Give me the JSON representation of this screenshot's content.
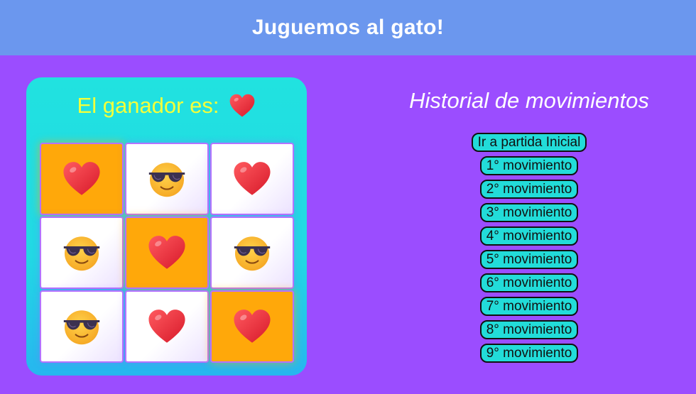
{
  "header": {
    "title": "Juguemos al gato!"
  },
  "status": {
    "label": "El ganador es:",
    "winner_icon": "heart-icon"
  },
  "board": {
    "cells": [
      {
        "mark": "heart",
        "highlight": true
      },
      {
        "mark": "cool",
        "highlight": false
      },
      {
        "mark": "heart",
        "highlight": false
      },
      {
        "mark": "cool",
        "highlight": false
      },
      {
        "mark": "heart",
        "highlight": true
      },
      {
        "mark": "cool",
        "highlight": false
      },
      {
        "mark": "cool",
        "highlight": false
      },
      {
        "mark": "heart",
        "highlight": false
      },
      {
        "mark": "heart",
        "highlight": true
      }
    ],
    "icon_names": {
      "heart": "heart-icon",
      "cool": "sunglasses-face-icon"
    }
  },
  "history": {
    "title": "Historial de movimientos",
    "moves": [
      "Ir a partida Inicial",
      "1° movimiento",
      "2° movimiento",
      "3° movimiento",
      "4° movimiento",
      "5° movimiento",
      "6° movimiento",
      "7° movimiento",
      "8° movimiento",
      "9° movimiento"
    ]
  },
  "colors": {
    "background": "#9b4dff",
    "header": "#6b97ee",
    "card": "#21e2e0",
    "winner_text": "#f3ff3a",
    "highlight_cell": "#ffa80a",
    "button": "#22dcd9"
  }
}
